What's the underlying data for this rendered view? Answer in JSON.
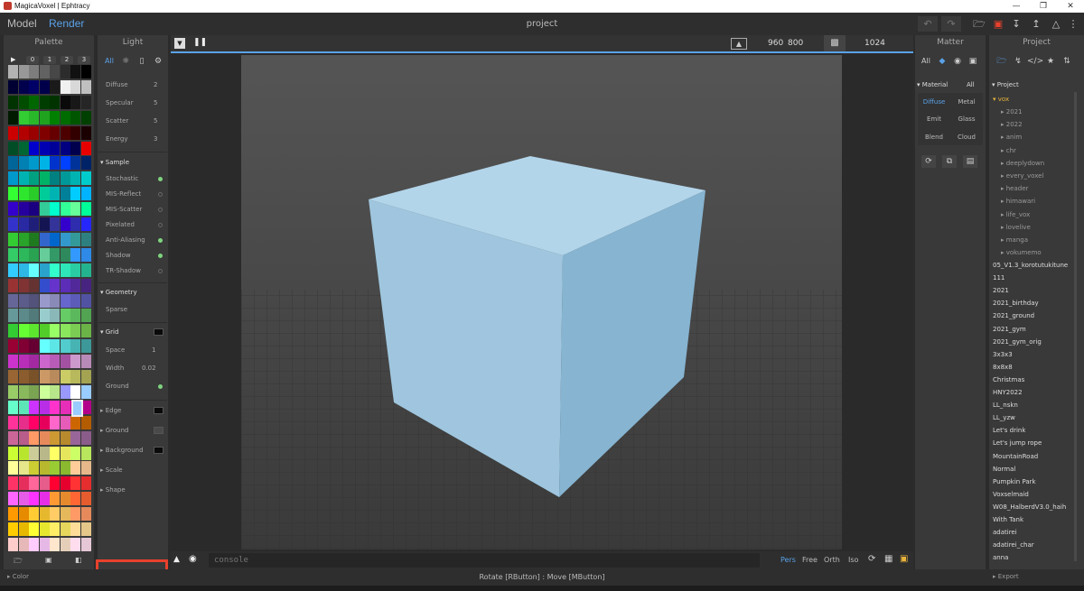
{
  "window": {
    "title": "MagicaVoxel | Ephtracy"
  },
  "topbar": {
    "model_tab": "Model",
    "render_tab": "Render",
    "project_title": "project"
  },
  "palette": {
    "title": "Palette",
    "pages": [
      "0",
      "1",
      "2",
      "3"
    ],
    "footer_label": "Color",
    "colors": [
      "#b3b3b3",
      "#989898",
      "#7d7d7d",
      "#626262",
      "#474747",
      "#2c2c2c",
      "#111111",
      "#000000",
      "#000033",
      "#00004d",
      "#000066",
      "#00004a",
      "#1a1a1a",
      "#f0f0f0",
      "#d8d8d8",
      "#c0c0c0",
      "#003300",
      "#004d00",
      "#006600",
      "#003d00",
      "#003300",
      "#0a0a0a",
      "#181818",
      "#262626",
      "#001a00",
      "#33cc33",
      "#29b829",
      "#1fa31f",
      "#008000",
      "#006b00",
      "#005500",
      "#004000",
      "#cc0000",
      "#b30000",
      "#990000",
      "#800000",
      "#660000",
      "#4d0000",
      "#330000",
      "#1a0000",
      "#004d26",
      "#006633",
      "#0000cc",
      "#0000b3",
      "#000099",
      "#000080",
      "#00004d",
      "#e60000",
      "#006699",
      "#0080b3",
      "#0099cc",
      "#00b3e6",
      "#0033cc",
      "#0040ff",
      "#003399",
      "#002266",
      "#0099cc",
      "#00b3b3",
      "#00a080",
      "#00b366",
      "#008080",
      "#009999",
      "#00b3b3",
      "#00cccc",
      "#33ff33",
      "#2ee62e",
      "#29cc29",
      "#00cc99",
      "#00b3b3",
      "#008099",
      "#00ccff",
      "#00b3ff",
      "#3300cc",
      "#26009e",
      "#1a0080",
      "#33cc99",
      "#00ffcc",
      "#33ff99",
      "#66ff99",
      "#00ff99",
      "#3333cc",
      "#2929a3",
      "#1f1f7a",
      "#141452",
      "#333399",
      "#3300cc",
      "#2d2dad",
      "#2626ff",
      "#33cc33",
      "#29a329",
      "#1f7a1f",
      "#3366cc",
      "#0066cc",
      "#3399cc",
      "#339999",
      "#2e8080",
      "#33cc66",
      "#2eb85c",
      "#29a352",
      "#66cc99",
      "#339966",
      "#2e8a5c",
      "#3399ff",
      "#2e8ae6",
      "#33ccff",
      "#2eb8e6",
      "#66ffff",
      "#29a3cc",
      "#33ffcc",
      "#2ee6b8",
      "#29cca3",
      "#24b38f",
      "#993333",
      "#803333",
      "#663333",
      "#334dcc",
      "#6633cc",
      "#5c2eb8",
      "#522999",
      "#472480",
      "#666699",
      "#5c5c8a",
      "#52527a",
      "#9999cc",
      "#8a8ab8",
      "#6666cc",
      "#5c5cb8",
      "#5252a3",
      "#669999",
      "#5c8a8a",
      "#527a7a",
      "#99cccc",
      "#8ab8b8",
      "#66cc66",
      "#5cb85c",
      "#52a352",
      "#33cc33",
      "#66ff33",
      "#5ce62e",
      "#52cc29",
      "#99ff66",
      "#8ae65c",
      "#7acc52",
      "#6bb347",
      "#990033",
      "#800033",
      "#660033",
      "#66ffff",
      "#5ce6e6",
      "#52cccc",
      "#47b3b3",
      "#3d9999",
      "#cc33cc",
      "#b82eb8",
      "#a329a3",
      "#cc66cc",
      "#b85cb8",
      "#a352a3",
      "#cc99cc",
      "#b88ab8",
      "#996633",
      "#8a5c2e",
      "#7a5229",
      "#cc9966",
      "#b88a5c",
      "#cccc66",
      "#b8b85c",
      "#a3a352",
      "#99cc66",
      "#8ab85c",
      "#7aa352",
      "#ccff99",
      "#b8e68a",
      "#9999ff",
      "#ffffff",
      "#99ccff",
      "#66ffcc",
      "#5ce6b8",
      "#cc33ff",
      "#b82ee6",
      "#ff33cc",
      "#e62eb8",
      "#cc0099",
      "#b3008a",
      "#ff3399",
      "#e62e8a",
      "#ff0066",
      "#e6005c",
      "#ff66cc",
      "#e65cb8",
      "#cc6600",
      "#b35c00",
      "#cc6699",
      "#b85c8a",
      "#ff9966",
      "#e68a5c",
      "#cc9933",
      "#b88a2e",
      "#996699",
      "#8a5c8a",
      "#ccff33",
      "#b8e62e",
      "#cccc99",
      "#b8b88a",
      "#ffff66",
      "#e6e65c",
      "#ccff66",
      "#b8e65c",
      "#ffff99",
      "#e6e68a",
      "#cccc33",
      "#b8b82e",
      "#99cc33",
      "#8ab82e",
      "#ffcc99",
      "#e6b88a",
      "#ff3366",
      "#e62e5c",
      "#ff6699",
      "#e65c8a",
      "#ff0033",
      "#e6002e",
      "#ff3333",
      "#e62e2e",
      "#ff66ff",
      "#e65ce6",
      "#ff33ff",
      "#e62ee6",
      "#ff9933",
      "#e68a2e",
      "#ff6633",
      "#e65c2e",
      "#ff9900",
      "#e68a00",
      "#ffcc33",
      "#e6b82e",
      "#ffcc66",
      "#e6b85c",
      "#ff9966",
      "#e68a5c",
      "#ffcc00",
      "#e6b800",
      "#ffff33",
      "#e6e62e",
      "#ffee66",
      "#e6d65c",
      "#ffdd99",
      "#e6c78a",
      "#ffcccc",
      "#e6b8b8",
      "#ffccff",
      "#e6b8e6",
      "#ffe6cc",
      "#e6cfb8",
      "#ffddee",
      "#e6c7d6"
    ]
  },
  "light": {
    "title": "Light",
    "filter_all": "All",
    "rows": [
      {
        "label": "Diffuse",
        "value": "2"
      },
      {
        "label": "Specular",
        "value": "5"
      },
      {
        "label": "Scatter",
        "value": "5"
      },
      {
        "label": "Energy",
        "value": "3"
      }
    ],
    "sample_title": "Sample",
    "sample": [
      {
        "label": "Stochastic",
        "on": true
      },
      {
        "label": "MIS-Reflect",
        "on": false
      },
      {
        "label": "MIS-Scatter",
        "on": false
      },
      {
        "label": "Pixelated",
        "on": false
      },
      {
        "label": "Anti-Aliasing",
        "on": true
      },
      {
        "label": "Shadow",
        "on": true
      },
      {
        "label": "TR-Shadow",
        "on": false
      }
    ],
    "geometry_title": "Geometry",
    "geometry_sparse": "Sparse",
    "grid_title": "Grid",
    "grid_space_label": "Space",
    "grid_space_value": "1",
    "grid_width_label": "Width",
    "grid_width_value": "0.02",
    "grid_ground_label": "Ground",
    "edge": "Edge",
    "ground": "Ground",
    "background": "Background",
    "scale": "Scale",
    "shape": "Shape"
  },
  "viewport": {
    "resolution_w": "960",
    "resolution_h": "800",
    "samples": "1024"
  },
  "console": {
    "placeholder": "console",
    "views": [
      "Pers",
      "Free",
      "Orth",
      "Iso"
    ],
    "active_view": "Pers"
  },
  "status": {
    "hint": "Rotate [RButton] : Move [MButton]"
  },
  "matter": {
    "title": "Matter",
    "filter_all": "All",
    "material_title": "Material",
    "material_all": "All",
    "materials": [
      "Diffuse",
      "Metal",
      "Emit",
      "Glass",
      "Blend",
      "Cloud"
    ],
    "active_material": "Diffuse"
  },
  "project": {
    "title": "Project",
    "tree_root": "Project",
    "folder": "vox",
    "subfolders": [
      "2021",
      "2022",
      "anim",
      "chr",
      "deeplydown",
      "every_voxel",
      "header",
      "himawari",
      "life_vox",
      "lovelive",
      "manga",
      "vokumemo"
    ],
    "files": [
      "05_V1.3_korotutukitune",
      "111",
      "2021",
      "2021_birthday",
      "2021_ground",
      "2021_gym",
      "2021_gym_orig",
      "3x3x3",
      "8x8x8",
      "Christmas",
      "HNY2022",
      "LL_nskn",
      "LL_yzw",
      "Let's drink",
      "Let's jump rope",
      "MountainRoad",
      "Normal",
      "Pumpkin Park",
      "Voxselmaid",
      "W08_HalberdV3.0_haih",
      "With Tank",
      "adatirei",
      "adatirei_char",
      "anna"
    ],
    "export": "Export"
  },
  "colors": {
    "accent": "#5aa2e8",
    "cube_top": "#b3d5ea",
    "cube_left": "#9fc6de",
    "cube_right": "#86b4d1",
    "highlight_box": "#e8412c",
    "folder": "#e8b33c"
  }
}
